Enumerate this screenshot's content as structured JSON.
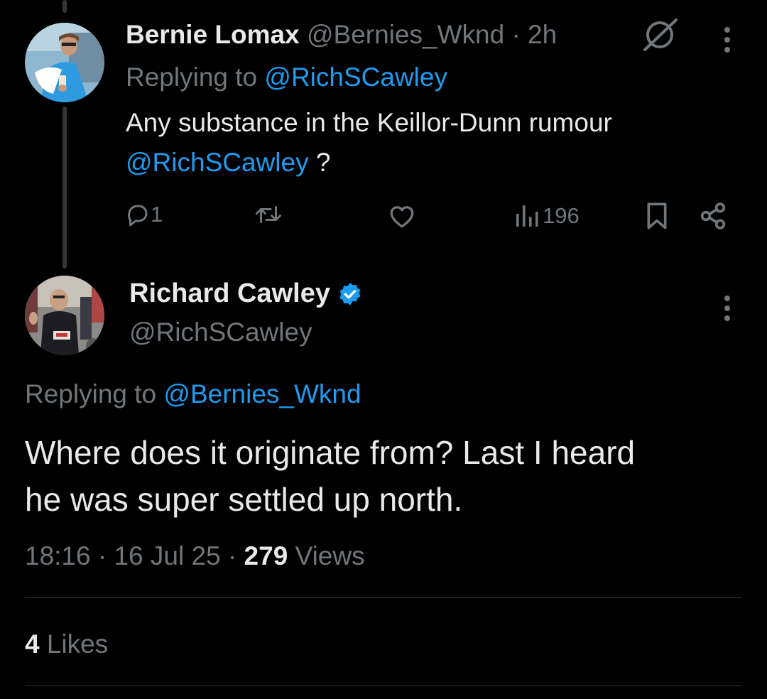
{
  "reply_tweet": {
    "author_name": "Bernie Lomax",
    "handle": "@Bernies_Wknd",
    "separator": "·",
    "time": "2h",
    "replying_prefix": "Replying to",
    "replying_to": "@RichSCawley",
    "text_line1": "Any substance in the Keillor-Dunn rumour",
    "text_mention": "@RichSCawley",
    "text_suffix": "?",
    "reply_count": "1",
    "views_count": "196",
    "icons": {
      "grok": "grok-icon",
      "more": "more-icon",
      "reply": "reply-icon",
      "retweet": "retweet-icon",
      "like": "like-icon",
      "views": "views-icon",
      "bookmark": "bookmark-icon",
      "share": "share-icon"
    }
  },
  "main_tweet": {
    "author_name": "Richard Cawley",
    "handle": "@RichSCawley",
    "verified_icon": "verified-badge-icon",
    "replying_prefix": "Replying to",
    "replying_to": "@Bernies_Wknd",
    "text_line1": "Where does it originate from? Last I heard",
    "text_line2": "he was super settled up north.",
    "timestamp_time": "18:16",
    "separator": "·",
    "timestamp_date": "16 Jul 25",
    "views_count": "279",
    "views_label": "Views",
    "likes_count": "4",
    "likes_label": "Likes"
  },
  "colors": {
    "background": "#000000",
    "text": "#e7e9ea",
    "muted": "#71767b",
    "accent": "#1d9bf0",
    "divider": "#2f3336"
  }
}
